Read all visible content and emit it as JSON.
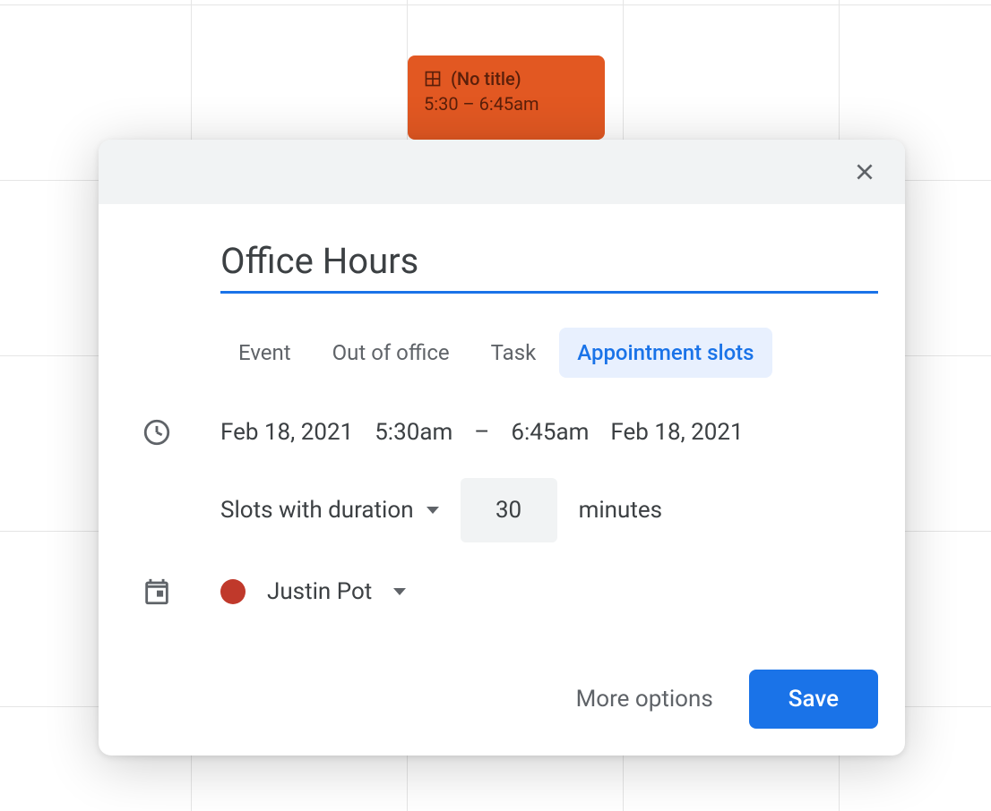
{
  "event_block": {
    "title": "(No title)",
    "time_range": "5:30 – 6:45am"
  },
  "modal": {
    "title": "Office Hours",
    "tabs": {
      "event": "Event",
      "out_of_office": "Out of office",
      "task": "Task",
      "appointment_slots": "Appointment slots"
    },
    "datetime": {
      "start_date": "Feb 18, 2021",
      "start_time": "5:30am",
      "separator": "–",
      "end_time": "6:45am",
      "end_date": "Feb 18, 2021"
    },
    "duration": {
      "label": "Slots with duration",
      "value": "30",
      "unit": "minutes"
    },
    "owner": {
      "name": "Justin Pot",
      "color": "#c0392b"
    },
    "footer": {
      "more_options": "More options",
      "save": "Save"
    }
  }
}
